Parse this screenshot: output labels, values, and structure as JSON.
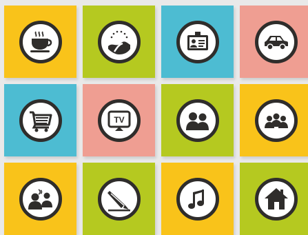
{
  "tiles": [
    {
      "id": "coffee",
      "icon": "coffee-cup-icon",
      "color": "#f9c31a"
    },
    {
      "id": "landscape",
      "icon": "landscape-icon",
      "color": "#b5c920"
    },
    {
      "id": "id-card",
      "icon": "id-card-icon",
      "color": "#4dbcd2"
    },
    {
      "id": "car",
      "icon": "car-icon",
      "color": "#ef9e92"
    },
    {
      "id": "cart",
      "icon": "shopping-cart-icon",
      "color": "#4dbcd2"
    },
    {
      "id": "tv",
      "icon": "tv-icon",
      "color": "#ef9e92",
      "label": "TV"
    },
    {
      "id": "two-people",
      "icon": "two-people-icon",
      "color": "#b5c920"
    },
    {
      "id": "group",
      "icon": "group-icon",
      "color": "#f9c31a"
    },
    {
      "id": "talk",
      "icon": "conversation-icon",
      "color": "#f9c31a"
    },
    {
      "id": "pencil",
      "icon": "pencil-icon",
      "color": "#b5c920"
    },
    {
      "id": "music",
      "icon": "music-note-icon",
      "color": "#f9c31a"
    },
    {
      "id": "home",
      "icon": "home-icon",
      "color": "#b5c920"
    }
  ],
  "icon_color": "#2f2d2b"
}
